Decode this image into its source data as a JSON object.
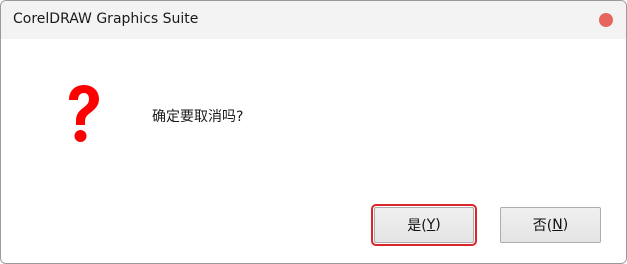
{
  "window": {
    "title": "CorelDRAW Graphics Suite",
    "close_icon": "close-icon",
    "close_color": "#e8655f"
  },
  "dialog": {
    "icon": "question-mark-icon",
    "icon_color": "#ff0000",
    "message": "确定要取消吗?"
  },
  "buttons": {
    "yes": {
      "prefix": "是(",
      "mnemonic": "Y",
      "suffix": ")"
    },
    "no": {
      "prefix": "否(",
      "mnemonic": "N",
      "suffix": ")"
    },
    "focus_highlight_color": "#d9262b"
  }
}
